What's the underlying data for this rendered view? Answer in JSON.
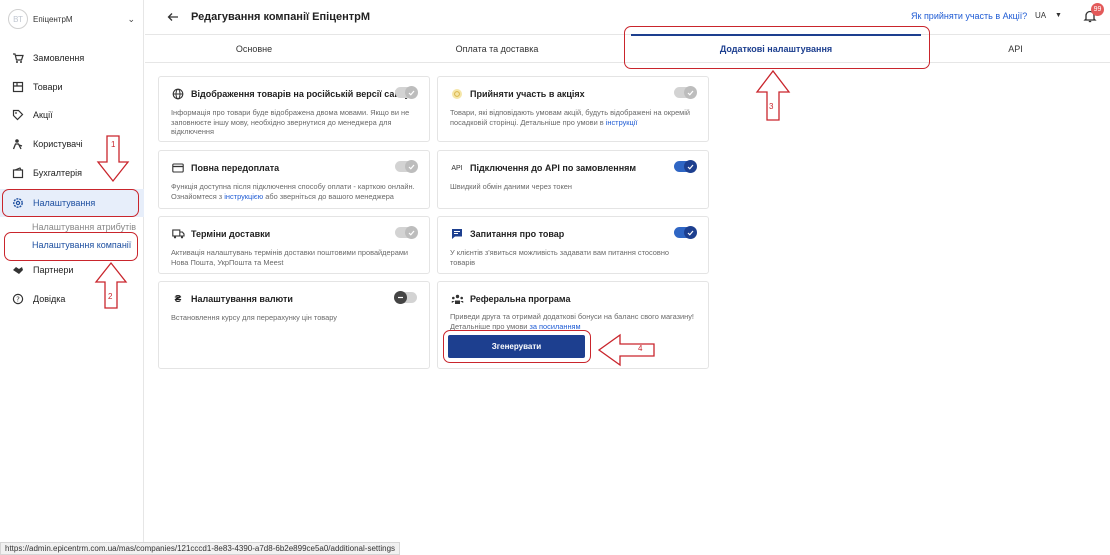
{
  "sidebar": {
    "avatar_initials": "ВТ",
    "company_name": "ЕпіцентрМ",
    "items": [
      {
        "label": "Замовлення",
        "icon": "cart-icon"
      },
      {
        "label": "Товари",
        "icon": "box-icon"
      },
      {
        "label": "Акції",
        "icon": "percent-tag-icon"
      },
      {
        "label": "Користувачі",
        "icon": "users-icon"
      },
      {
        "label": "Бухгалтерія",
        "icon": "wallet-icon"
      },
      {
        "label": "Налаштування",
        "icon": "gear-icon"
      },
      {
        "label": "Партнери",
        "icon": "handshake-icon"
      },
      {
        "label": "Довідка",
        "icon": "help-icon"
      }
    ],
    "subitems": [
      {
        "label": "Налаштування атрибутів"
      },
      {
        "label": "Налаштування компанії"
      }
    ]
  },
  "header": {
    "title": "Редагування компанії ЕпіцентрМ",
    "promo_link": "Як прийняти участь в Акції?",
    "language": "UA",
    "notifications_count": "99"
  },
  "tabs": [
    {
      "label": "Основне"
    },
    {
      "label": "Оплата та доставка"
    },
    {
      "label": "Додаткові налаштування"
    },
    {
      "label": "API"
    }
  ],
  "cards": {
    "russian": {
      "title": "Відображення товарів на російській версії сайту",
      "desc": "Інформація про товари буде відображена двома мовами. Якщо ви не заповнюєте іншу мову, необхідно звернутися до менеджера для відключення",
      "toggle": "on-disabled"
    },
    "promo": {
      "title": "Прийняти участь в акціях",
      "desc_a": "Товари, які відповідають умовам акцій, будуть відображені на окремій посадковій сторінці. Детальніше про умови в ",
      "desc_link": "інструкції",
      "toggle": "on-disabled"
    },
    "prepay": {
      "title": "Повна передоплата",
      "desc_a": "Функція доступна після підключення способу оплати - карткою онлайн. Ознайомтеся з ",
      "desc_link": "інструкцією",
      "desc_b": " або зверніться до вашого менеджера",
      "toggle": "on-disabled"
    },
    "api": {
      "title": "Підключення до API по замовленням",
      "icon_text": "API",
      "desc": "Швидкий обмін даними через токен",
      "toggle": "on"
    },
    "delivery": {
      "title": "Терміни доставки",
      "desc": "Активація налаштувань термінів доставки поштовими провайдерами Нова Пошта, УкрПошта та Meest",
      "toggle": "on-disabled"
    },
    "question": {
      "title": "Запитання про товар",
      "desc": "У клієнтів з'явиться можливість задавати вам питання стосовно товарів",
      "toggle": "on"
    },
    "currency": {
      "title": "Налаштування валюти",
      "icon_text": "₴",
      "desc": "Встановлення курсу для перерахунку цін товару",
      "toggle": "off"
    },
    "referral": {
      "title": "Реферальна програма",
      "desc_a": "Приведи друга та отримай додаткові бонуси на баланс свого магазину! Детальніше про умови ",
      "desc_link": "за посиланням",
      "button": "Згенерувати"
    }
  },
  "annotations": {
    "n1": "1",
    "n2": "2",
    "n3": "3",
    "n4": "4",
    "color": "#c9252c"
  },
  "status_url": "https://admin.epicentrm.com.ua/mas/companies/121cccd1-8e83-4390-a7d8-6b2e899ce5a0/additional-settings",
  "colors": {
    "accent": "#1d3f8f",
    "link": "#1e5bd4",
    "active_bg": "#e7eefa"
  }
}
